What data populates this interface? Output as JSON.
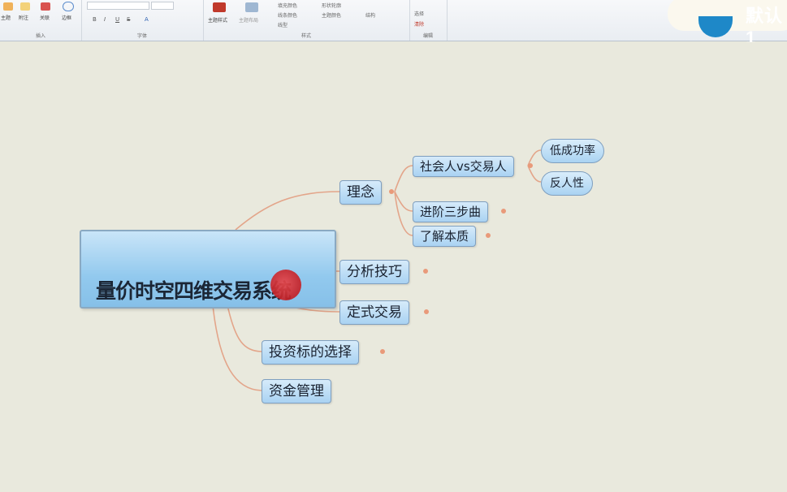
{
  "ribbon": {
    "insert": {
      "buttons": [
        "主题",
        "附注",
        "关联",
        "边框"
      ],
      "group_label": "插入"
    },
    "font": {
      "format_buttons": [
        "B",
        "I",
        "U",
        "S",
        "A"
      ],
      "group_label": "字体"
    },
    "style": {
      "buttons": [
        "主题样式",
        "主题布局"
      ],
      "rows": [
        "填充颜色",
        "线条颜色",
        "线型",
        "形状轮廓",
        "主题颜色",
        "结构"
      ],
      "group_label": "样式"
    },
    "edit": {
      "buttons": [
        "选择",
        "清除"
      ],
      "group_label": "编辑"
    }
  },
  "overlay_text": "默认1",
  "mindmap": {
    "central": "量价时空四维交易系统",
    "branches": {
      "concept": {
        "label": "理念",
        "children": {
          "social": {
            "label": "社会人vs交易人",
            "children": [
              "低成功率",
              "反人性"
            ]
          },
          "steps": "进阶三步曲",
          "essence": "了解本质"
        }
      },
      "analysis": "分析技巧",
      "fixed": "定式交易",
      "targets": "投资标的选择",
      "capital": "资金管理"
    }
  },
  "colors": {
    "connector": "#e3a58a",
    "topic_fill": "#a9d2f2",
    "background": "#e9e9dd"
  }
}
